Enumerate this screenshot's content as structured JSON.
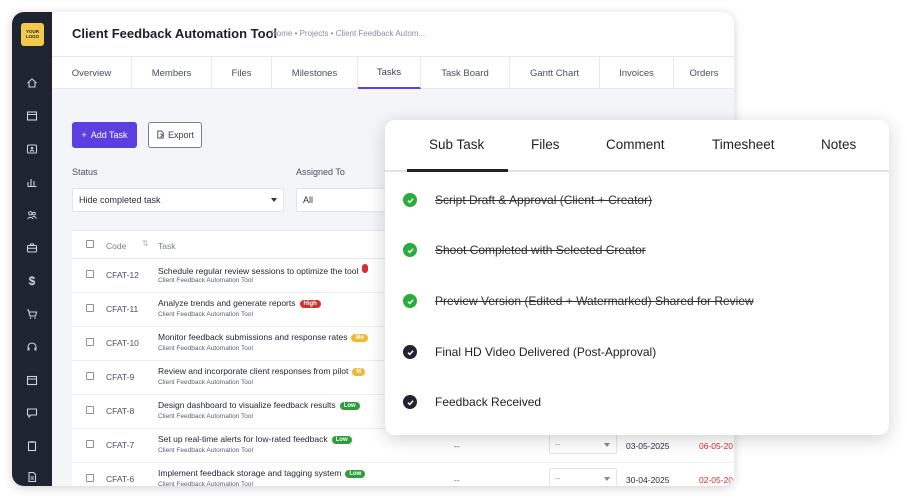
{
  "app": {
    "logo_text": "YOUR LOGO",
    "title": "Client Feedback Automation Tool",
    "breadcrumb": "Home • Projects • Client Feedback Autom..."
  },
  "sidebar": {
    "icons": [
      "home-icon",
      "window-icon",
      "id-card-icon",
      "chart-icon",
      "users-icon",
      "briefcase-icon",
      "dollar-icon",
      "cart-icon",
      "headset-icon",
      "calendar-icon",
      "chat-icon",
      "clipboard-icon",
      "document-icon"
    ]
  },
  "tabs": [
    "Overview",
    "Members",
    "Files",
    "Milestones",
    "Tasks",
    "Task Board",
    "Gantt Chart",
    "Invoices",
    "Orders"
  ],
  "toolbar": {
    "add_task_label": "Add Task",
    "export_label": "Export"
  },
  "filters": {
    "status_label": "Status",
    "status_value": "Hide completed task",
    "assigned_label": "Assigned To",
    "assigned_value": "All"
  },
  "table": {
    "headers": {
      "code": "Code",
      "task": "Task"
    },
    "rows": [
      {
        "code": "CFAT-12",
        "name": "Schedule regular review sessions to optimize the tool",
        "project": "Client Feedback Automation Tool",
        "priority": "",
        "priority_class": "high",
        "assignee": "",
        "status": "",
        "start": "",
        "end": ""
      },
      {
        "code": "CFAT-11",
        "name": "Analyze trends and generate reports",
        "project": "Client Feedback Automation Tool",
        "priority": "High",
        "priority_class": "high",
        "assignee": "",
        "status": "",
        "start": "",
        "end": ""
      },
      {
        "code": "CFAT-10",
        "name": "Monitor feedback submissions and response rates",
        "project": "Client Feedback Automation Tool",
        "priority": "Me",
        "priority_class": "med",
        "assignee": "",
        "status": "",
        "start": "",
        "end": ""
      },
      {
        "code": "CFAT-9",
        "name": "Review and incorporate client responses from pilot",
        "project": "Client Feedback Automation Tool",
        "priority": "M",
        "priority_class": "med",
        "assignee": "",
        "status": "",
        "start": "",
        "end": ""
      },
      {
        "code": "CFAT-8",
        "name": "Design dashboard to visualize feedback results",
        "project": "Client Feedback Automation Tool",
        "priority": "Low",
        "priority_class": "low",
        "assignee": "",
        "status": "",
        "start": "",
        "end": ""
      },
      {
        "code": "CFAT-7",
        "name": "Set up real-time alerts for low-rated feedback",
        "project": "Client Feedback Automation Tool",
        "priority": "Low",
        "priority_class": "low",
        "assignee": "--",
        "status": "--",
        "start": "03-05-2025",
        "end": "06-05-20"
      },
      {
        "code": "CFAT-6",
        "name": "Implement feedback storage and tagging system",
        "project": "Client Feedback Automation Tool",
        "priority": "Low",
        "priority_class": "low",
        "assignee": "--",
        "status": "--",
        "start": "30-04-2025",
        "end": "02-05-20"
      }
    ]
  },
  "subtask_popup": {
    "tabs": [
      "Sub Task",
      "Files",
      "Comment",
      "Timesheet",
      "Notes"
    ],
    "items": [
      {
        "text": "Script Draft & Approval (Client + Creator)",
        "done": true
      },
      {
        "text": "Shoot Completed with Selected Creator",
        "done": true
      },
      {
        "text": "Preview Version (Edited + Watermarked) Shared for Review",
        "done": true
      },
      {
        "text": "Final HD Video Delivered (Post-Approval)",
        "done": false
      },
      {
        "text": "Feedback Received",
        "done": false
      }
    ]
  },
  "colors": {
    "accent": "#5b3fe0",
    "sidebar": "#1e2430",
    "done": "#27ae3c",
    "high": "#d32f2f",
    "low": "#2e9e3a",
    "medium": "#f2b632"
  }
}
